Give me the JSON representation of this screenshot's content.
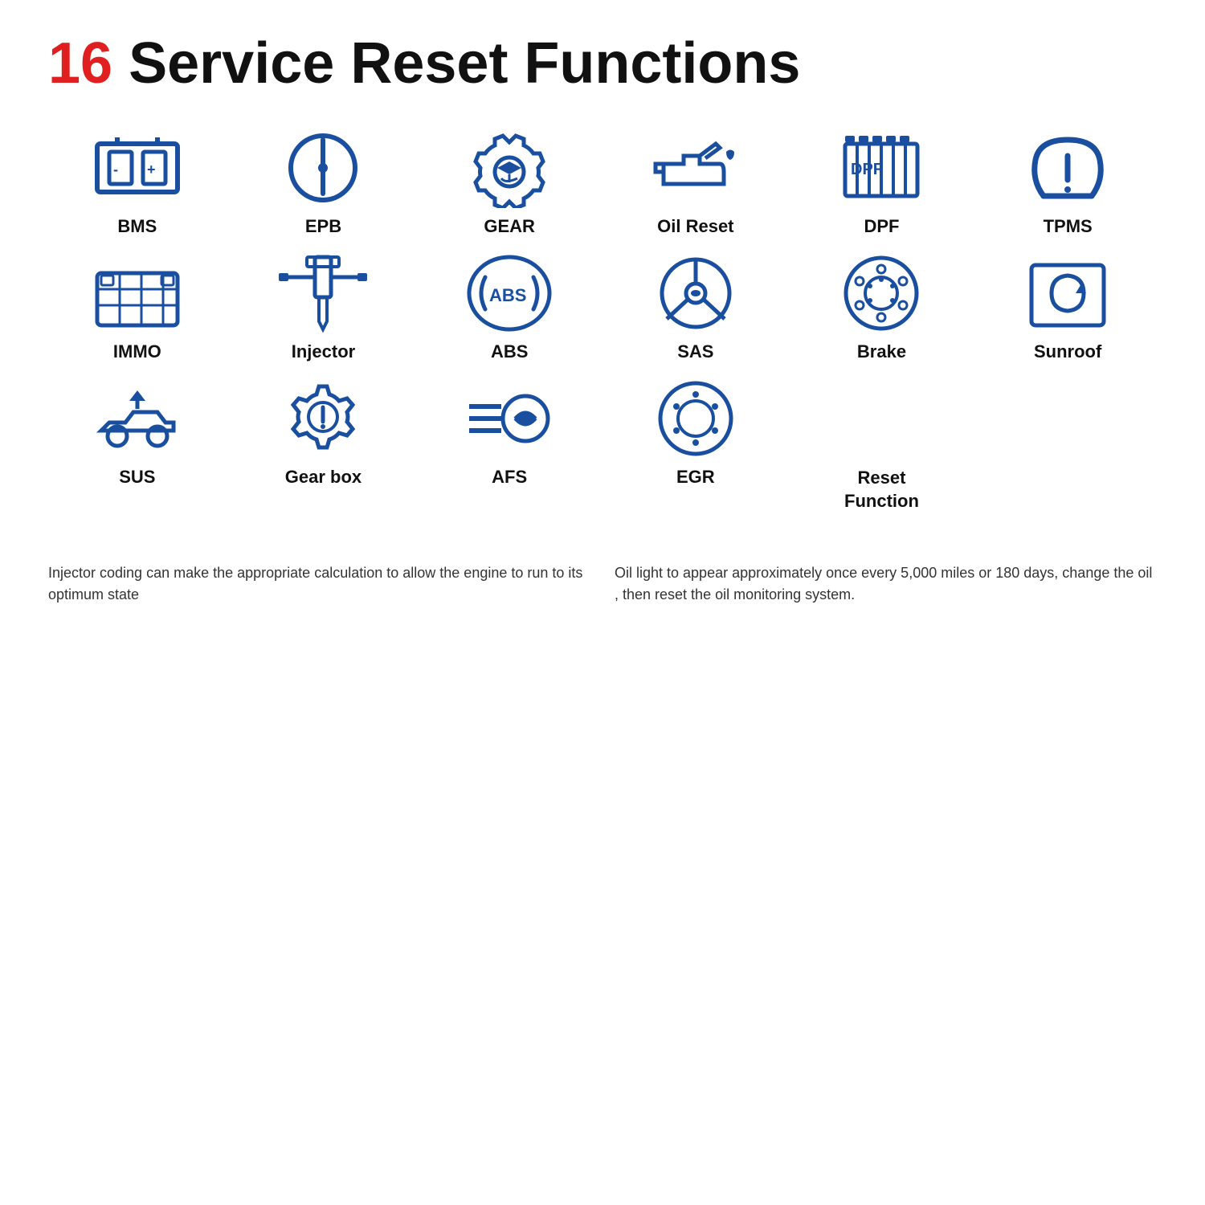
{
  "title": {
    "number": "16",
    "text": " Service Reset Functions"
  },
  "functions": [
    {
      "id": "bms",
      "label": "BMS",
      "icon": "battery"
    },
    {
      "id": "epb",
      "label": "EPB",
      "icon": "epb"
    },
    {
      "id": "gear",
      "label": "GEAR",
      "icon": "gear"
    },
    {
      "id": "oil-reset",
      "label": "Oil Reset",
      "icon": "oil"
    },
    {
      "id": "dpf",
      "label": "DPF",
      "icon": "dpf"
    },
    {
      "id": "tpms",
      "label": "TPMS",
      "icon": "tpms"
    },
    {
      "id": "immo",
      "label": "IMMO",
      "icon": "immo"
    },
    {
      "id": "injector",
      "label": "Injector",
      "icon": "injector"
    },
    {
      "id": "abs",
      "label": "ABS",
      "icon": "abs"
    },
    {
      "id": "sas",
      "label": "SAS",
      "icon": "sas"
    },
    {
      "id": "brake",
      "label": "Brake",
      "icon": "brake"
    },
    {
      "id": "sunroof",
      "label": "Sunroof",
      "icon": "sunroof"
    },
    {
      "id": "sus",
      "label": "SUS",
      "icon": "sus"
    },
    {
      "id": "gearbox",
      "label": "Gear box",
      "icon": "gearbox"
    },
    {
      "id": "afs",
      "label": "AFS",
      "icon": "afs"
    },
    {
      "id": "egr",
      "label": "EGR",
      "icon": "egr"
    },
    {
      "id": "reset",
      "label": "Reset Function",
      "icon": "reset"
    }
  ],
  "photos": [
    {
      "id": "injector-photo",
      "type": "injector",
      "caption": "Injector coding can make the appropriate calculation to allow the engine to run to its optimum state"
    },
    {
      "id": "oil-photo",
      "type": "oil",
      "caption": "Oil light to appear approximately once every 5,000 miles or 180 days, change the oil , then reset the oil monitoring system."
    }
  ],
  "colors": {
    "red": "#e02020",
    "blue": "#1a4fa0",
    "dark": "#111111",
    "gray": "#555555"
  }
}
